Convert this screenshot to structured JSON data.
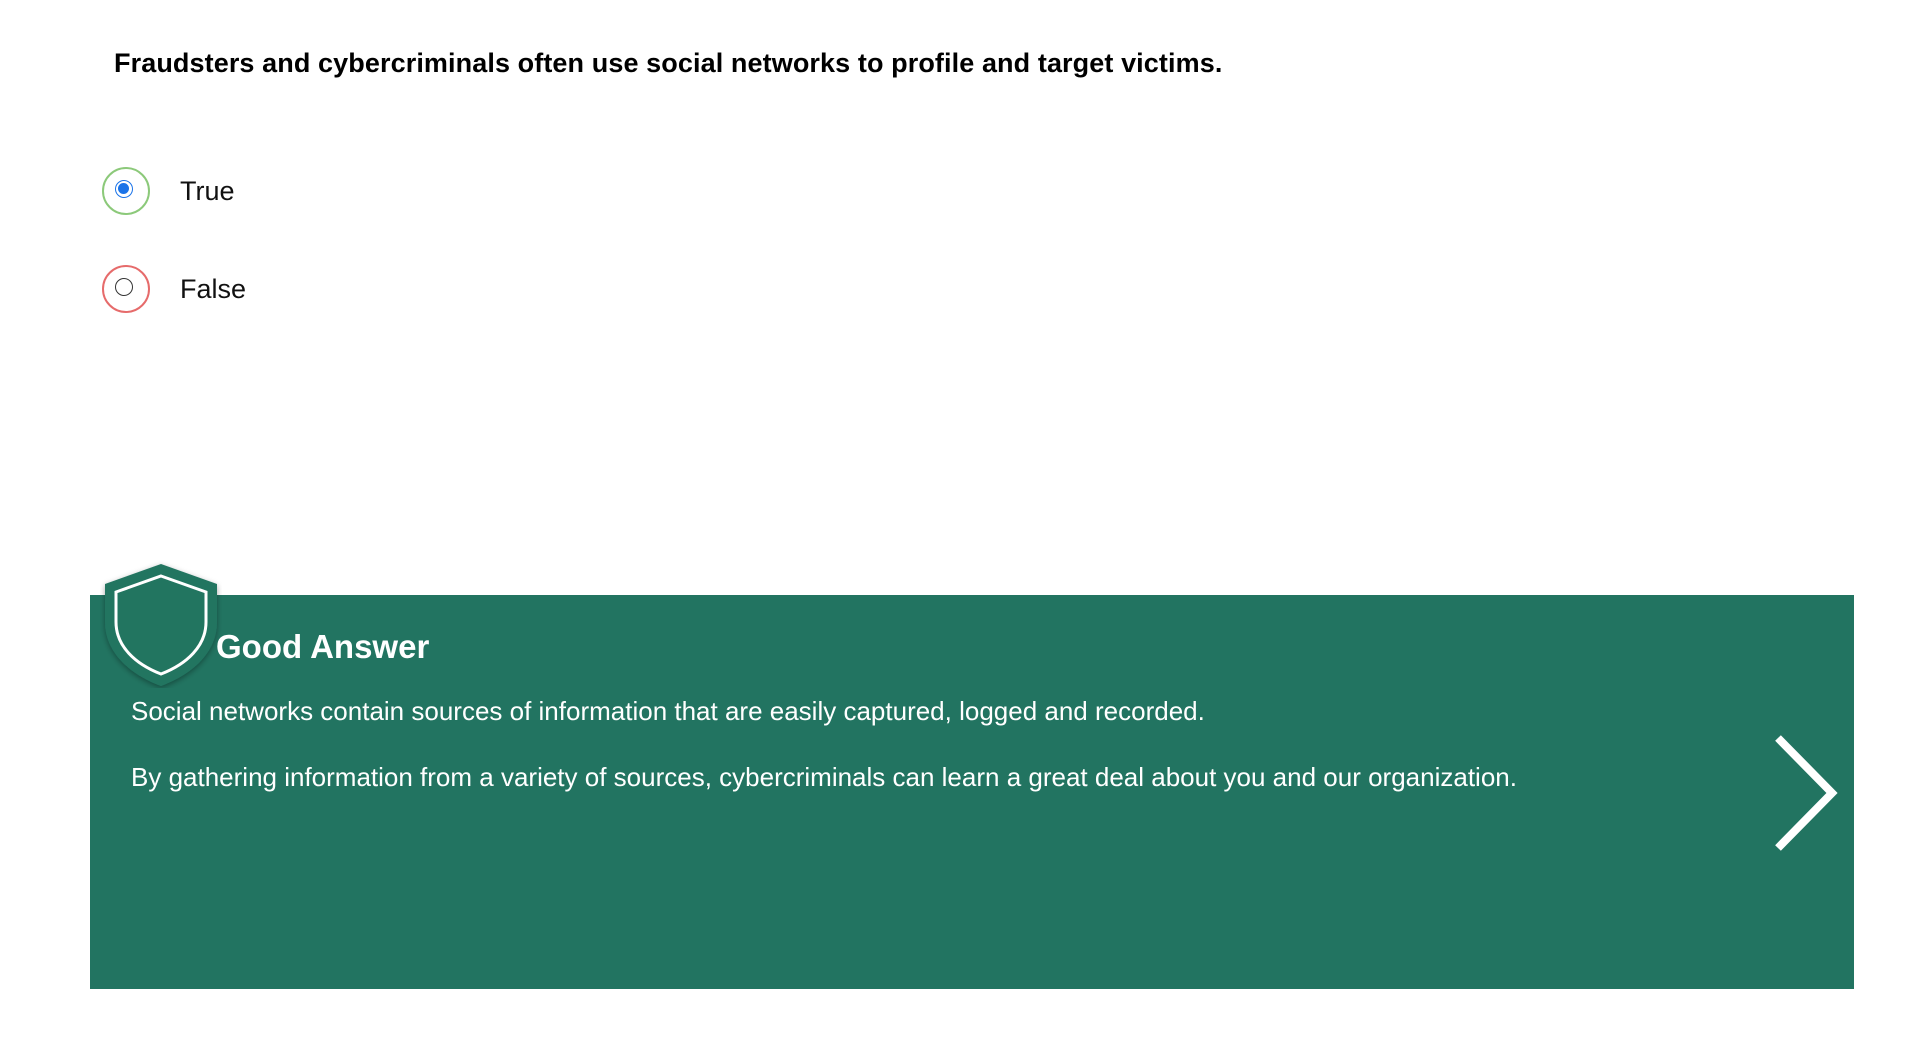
{
  "question": {
    "text": "Fraudsters and cybercriminals often use social networks to profile and target victims."
  },
  "options": [
    {
      "label": "True",
      "selected": true,
      "ring_color": "#8cc97a"
    },
    {
      "label": "False",
      "selected": false,
      "ring_color": "#e66b6b"
    }
  ],
  "feedback": {
    "icon": "shield-icon",
    "title": "Good Answer",
    "paragraphs": [
      "Social networks contain sources of information that are easily captured, logged and recorded.",
      "By gathering information from a variety of sources, cybercriminals can learn a great deal about you and our organization."
    ],
    "background_color": "#227461",
    "next_icon": "chevron-right-icon"
  }
}
